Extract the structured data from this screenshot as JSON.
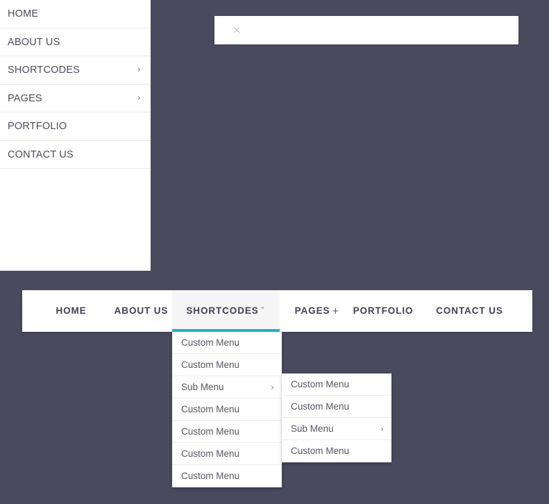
{
  "theme": {
    "background_color": "#4a4a5e",
    "panel_color": "#ffffff",
    "accent_color": "#22b4cc",
    "text_color": "#40404f",
    "muted_text_color": "#56565f",
    "active_tab_background": "#f5f5f5"
  },
  "search_bar": {
    "close_icon": "×",
    "value": "",
    "placeholder": ""
  },
  "sidebar": {
    "items": [
      {
        "label": "HOME",
        "arrow": ""
      },
      {
        "label": "ABOUT US",
        "arrow": ""
      },
      {
        "label": "SHORTCODES",
        "arrow": "›"
      },
      {
        "label": "PAGES",
        "arrow": "›"
      },
      {
        "label": "PORTFOLIO",
        "arrow": ""
      },
      {
        "label": "CONTACT US",
        "arrow": ""
      }
    ]
  },
  "topnav": {
    "items": [
      {
        "label": "HOME",
        "marker": "",
        "active": false
      },
      {
        "label": "ABOUT US",
        "marker": "",
        "active": false
      },
      {
        "label": "SHORTCODES",
        "marker": "ˇ",
        "active": true
      },
      {
        "label": "PAGES",
        "marker": "+",
        "active": false
      },
      {
        "label": "PORTFOLIO",
        "marker": "",
        "active": false
      },
      {
        "label": "CONTACT US",
        "marker": "",
        "active": false
      }
    ]
  },
  "dropdown_level_1": {
    "items": [
      {
        "label": "Custom Menu",
        "arrow": ""
      },
      {
        "label": "Custom Menu",
        "arrow": ""
      },
      {
        "label": "Sub Menu",
        "arrow": "›"
      },
      {
        "label": "Custom Menu",
        "arrow": ""
      },
      {
        "label": "Custom Menu",
        "arrow": ""
      },
      {
        "label": "Custom Menu",
        "arrow": ""
      },
      {
        "label": "Custom Menu",
        "arrow": ""
      }
    ]
  },
  "dropdown_level_2": {
    "items": [
      {
        "label": "Custom Menu",
        "arrow": ""
      },
      {
        "label": "Custom Menu",
        "arrow": ""
      },
      {
        "label": "Sub Menu",
        "arrow": "›"
      },
      {
        "label": "Custom Menu",
        "arrow": ""
      }
    ]
  }
}
